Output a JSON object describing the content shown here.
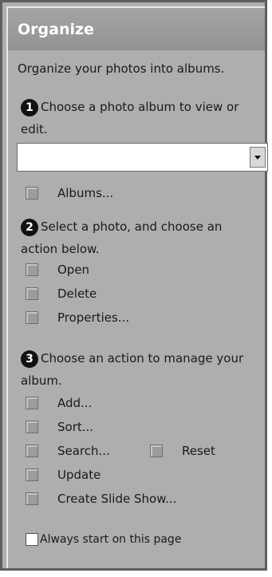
{
  "pane": {
    "title": "Organize",
    "subtitle": "Organize your photos into albums."
  },
  "step1": {
    "number": "1",
    "text": "Choose a photo album to view or edit.",
    "album_select_value": "",
    "icon": "dropdown-arrow-icon",
    "albums_label": "Albums..."
  },
  "step2": {
    "number": "2",
    "text": "Select a photo, and choose an action below.",
    "actions": [
      "Open",
      "Delete",
      "Properties..."
    ]
  },
  "step3": {
    "number": "3",
    "text": "Choose an action to manage your album.",
    "actions": [
      "Add...",
      "Sort...",
      "Search...",
      "Reset",
      "Update",
      "Create Slide Show..."
    ]
  },
  "footer": {
    "always_start_label": "Always start on this page",
    "always_start_checked": false
  }
}
